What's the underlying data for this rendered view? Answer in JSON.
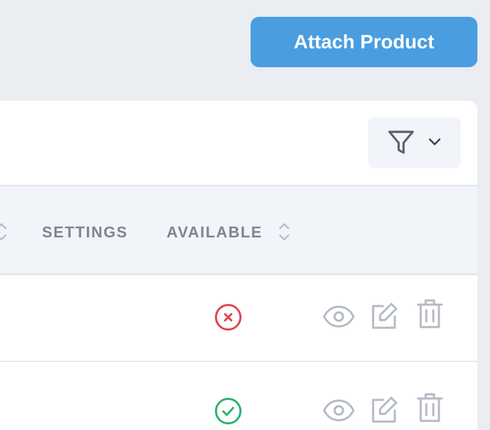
{
  "header": {
    "attach_label": "Attach Product"
  },
  "filter": {
    "icon": "filter-icon",
    "dropdown_icon": "chevron-down-icon"
  },
  "table": {
    "columns": [
      {
        "label": "SETTINGS",
        "sortable": false
      },
      {
        "label": "AVAILABLE",
        "sortable": true
      }
    ],
    "rows": [
      {
        "available": false,
        "status_icon": "x-circle-icon",
        "status_color": "#e0444f"
      },
      {
        "available": true,
        "status_icon": "check-circle-icon",
        "status_color": "#2db36a"
      }
    ],
    "row_actions": [
      "view-icon",
      "edit-icon",
      "delete-icon"
    ]
  },
  "colors": {
    "accent": "#4a9ee0",
    "background": "#eaedf2",
    "header_bg": "#f1f4f8",
    "icon_gray": "#b4bac3"
  }
}
